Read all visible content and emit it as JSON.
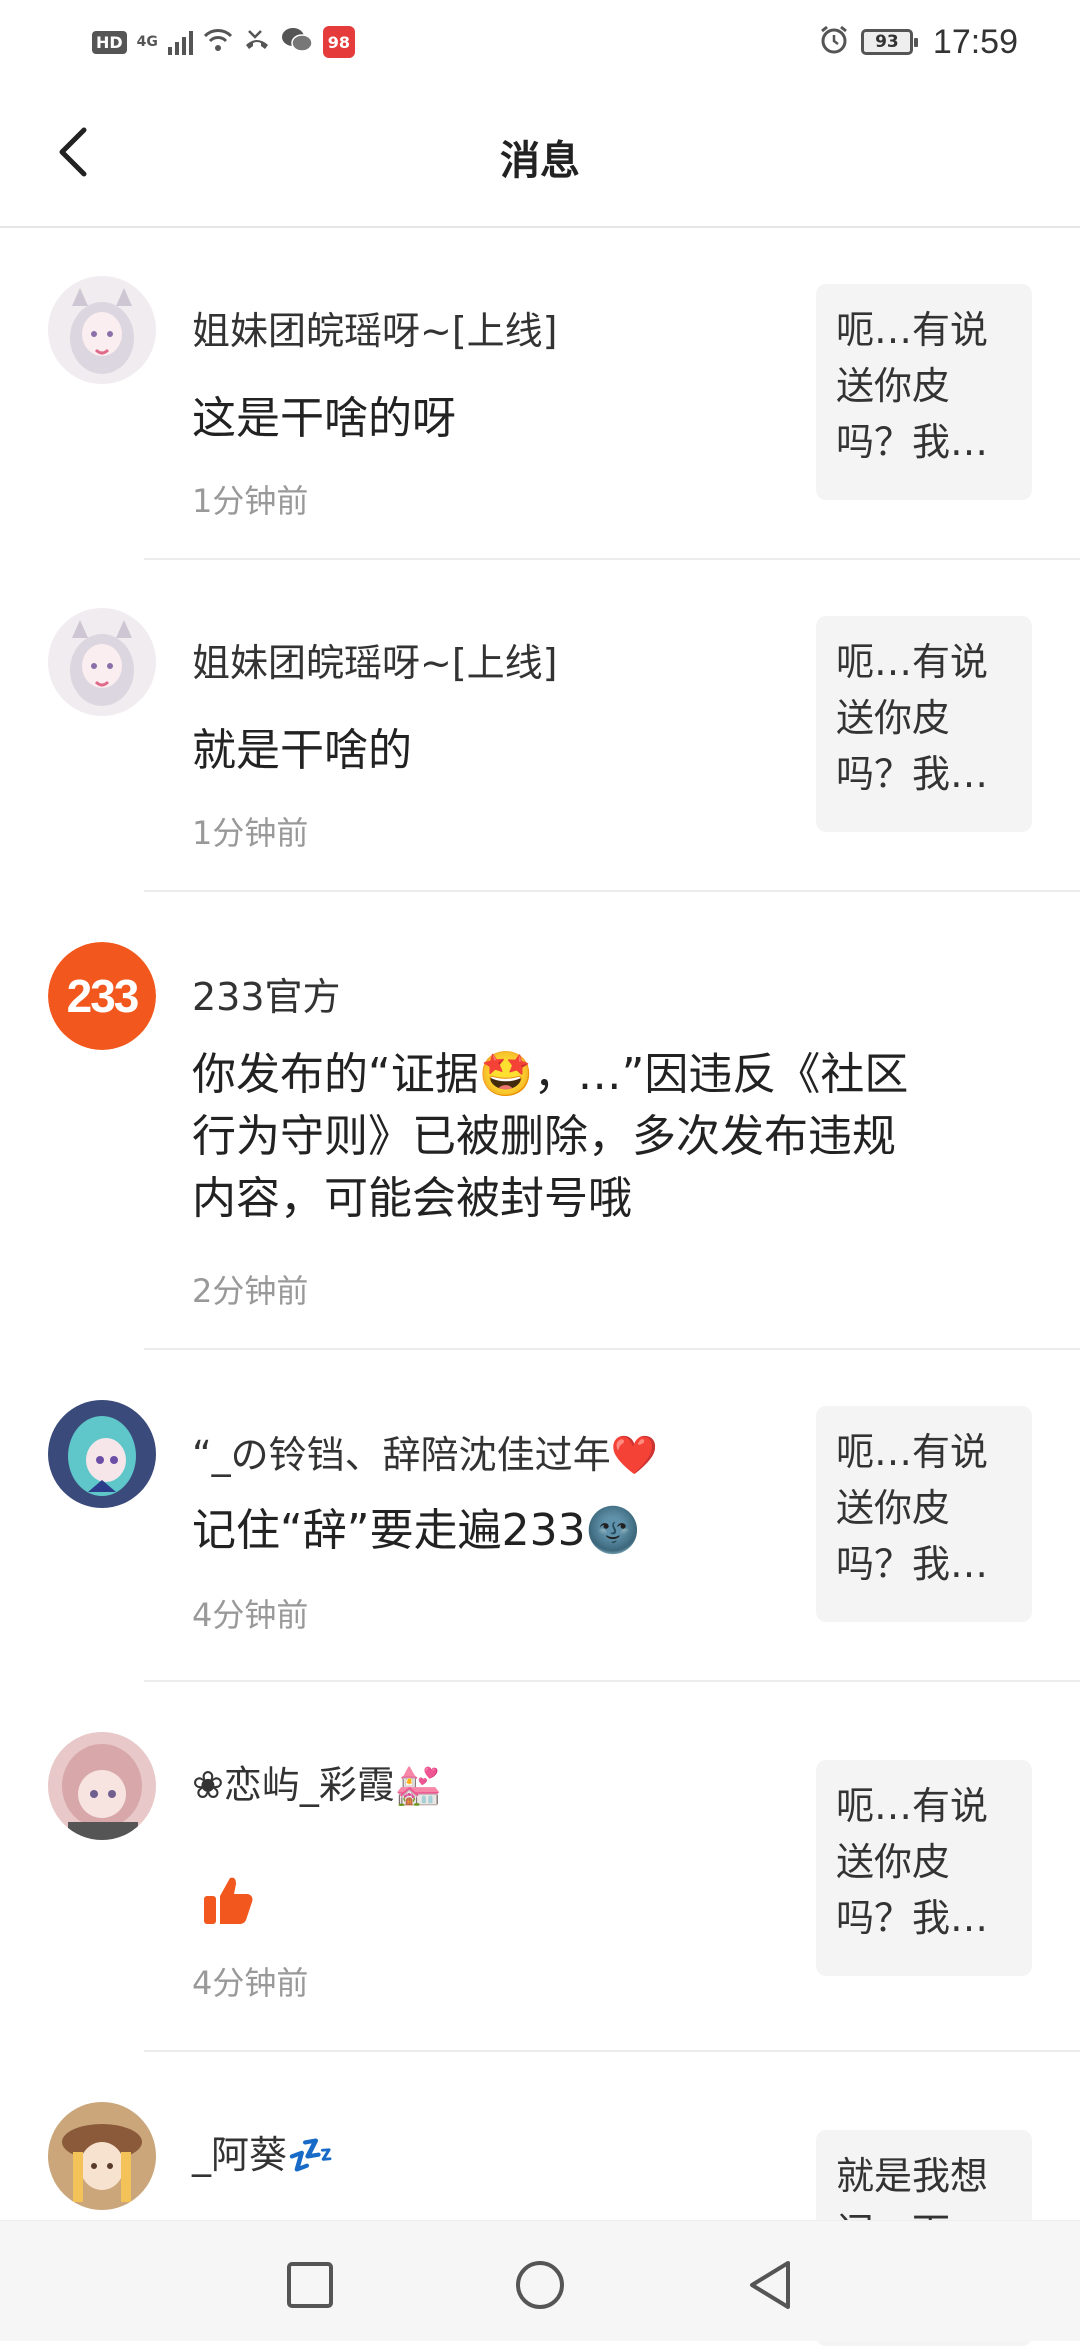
{
  "status_bar": {
    "hd_label": "HD",
    "network": "4G",
    "battery": "93",
    "time": "17:59",
    "app_badge": "98"
  },
  "header": {
    "title": "消息"
  },
  "messages": [
    {
      "nickname": "姐妹团皖瑶呀~[上线]",
      "text": "这是干啥的呀",
      "time": "1分钟前",
      "quote": "呃…有说送你皮吗？我…"
    },
    {
      "nickname": "姐妹团皖瑶呀~[上线]",
      "text": "就是干啥的",
      "time": "1分钟前",
      "quote": "呃…有说送你皮吗？我…"
    },
    {
      "nickname": "233官方",
      "avatar_label": "233",
      "text_line1": "你发布的“证据🤩，…”因违反《社区",
      "text_line2": "行为守则》已被删除，多次发布违规",
      "text_line3": "内容，可能会被封号哦",
      "time": "2分钟前"
    },
    {
      "nickname": "“_の铃铛、辞陪沈佳过年❤️",
      "text": "记住“辞”要走遍233🌚",
      "time": "4分钟前",
      "quote": "呃…有说送你皮吗？我…"
    },
    {
      "nickname": "❀恋屿_彩霞💒",
      "time": "4分钟前",
      "quote": "呃…有说送你皮吗？我…"
    },
    {
      "nickname": "_阿葵💤",
      "quote": "就是我想问一下"
    }
  ],
  "colors": {
    "brand_orange": "#f2581d",
    "separator": "#ececec",
    "quote_bg": "#f4f4f4",
    "time_gray": "#999999"
  }
}
